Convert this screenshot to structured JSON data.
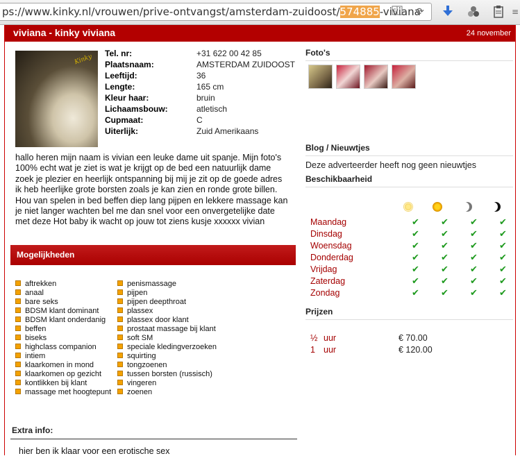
{
  "browser": {
    "url_prefix": "ps://www.kinky.nl/vrouwen/prive-ontvangst/amsterdam-zuidoost/",
    "url_highlight": "574885",
    "url_suffix": "-viviana",
    "icons": [
      "reader-icon",
      "reload-icon",
      "download-icon",
      "extension-icon",
      "clipboard-icon"
    ]
  },
  "header": {
    "title": "viviana - kinky viviana",
    "date": "24 november"
  },
  "profile": {
    "fields": [
      {
        "label": "Tel. nr:",
        "value": "+31 622 00 42 85"
      },
      {
        "label": "Plaatsnaam:",
        "value": "AMSTERDAM ZUIDOOST"
      },
      {
        "label": "Leeftijd:",
        "value": "36"
      },
      {
        "label": "Lengte:",
        "value": "165 cm"
      },
      {
        "label": "Kleur haar:",
        "value": "bruin"
      },
      {
        "label": "Lichaamsbouw:",
        "value": "atletisch"
      },
      {
        "label": "Cupmaat:",
        "value": "C"
      },
      {
        "label": "Uiterlijk:",
        "value": "Zuid Amerikaans"
      }
    ],
    "description": "hallo heren mijn naam is vivian een leuke dame uit spanje. Mijn foto's 100% echt wat je ziet is wat je krijgt op de bed een natuurlijk dame zoek je plezier en heerlijk ontspanning bij mij je zit op de goede adres ik heb heerlijke grote borsten zoals je kan zien en ronde grote billen. Hou van spelen in bed beffen diep lang pijpen en lekkere massage kan je niet langer wachten bel me dan snel voor een onvergetelijke date met deze Hot baby ik wacht op jouw tot ziens kusje xxxxxx vivian"
  },
  "options": {
    "title": "Mogelijkheden",
    "col1": [
      "aftrekken",
      "anaal",
      "bare seks",
      "BDSM klant dominant",
      "BDSM klant onderdanig",
      "beffen",
      "biseks",
      "highclass companion",
      "intiem",
      "klaarkomen in mond",
      "klaarkomen op gezicht",
      "kontlikken bij klant",
      "massage met hoogtepunt"
    ],
    "col2": [
      "penismassage",
      "pijpen",
      "pijpen deepthroat",
      "plassex",
      "plassex door klant",
      "prostaat massage bij klant",
      "soft SM",
      "speciale kledingverzoeken",
      "squirting",
      "tongzoenen",
      "tussen borsten (russisch)",
      "vingeren",
      "zoenen"
    ]
  },
  "extra": {
    "title": "Extra info:",
    "text": "hier ben ik klaar voor een erotische sex"
  },
  "photos": {
    "title": "Foto's",
    "count": 4
  },
  "blog": {
    "title": "Blog / Nieuwtjes",
    "text": "Deze adverteerder heeft nog geen nieuwtjes"
  },
  "availability": {
    "title": "Beschikbaarheid",
    "period_icons": [
      "morning-icon",
      "afternoon-icon",
      "evening-icon",
      "night-icon"
    ],
    "days": [
      "Maandag",
      "Dinsdag",
      "Woensdag",
      "Donderdag",
      "Vrijdag",
      "Zaterdag",
      "Zondag"
    ],
    "check_glyph": "✔"
  },
  "prices": {
    "title": "Prijzen",
    "rows": [
      {
        "duration": "½",
        "unit": "uur",
        "price": "€ 70.00"
      },
      {
        "duration": "1",
        "unit": "uur",
        "price": "€ 120.00"
      }
    ]
  },
  "colors": {
    "brand_red": "#b30000",
    "link_red": "#a40000",
    "check_green": "#1e9a1e",
    "option_orange": "#f4a200"
  }
}
